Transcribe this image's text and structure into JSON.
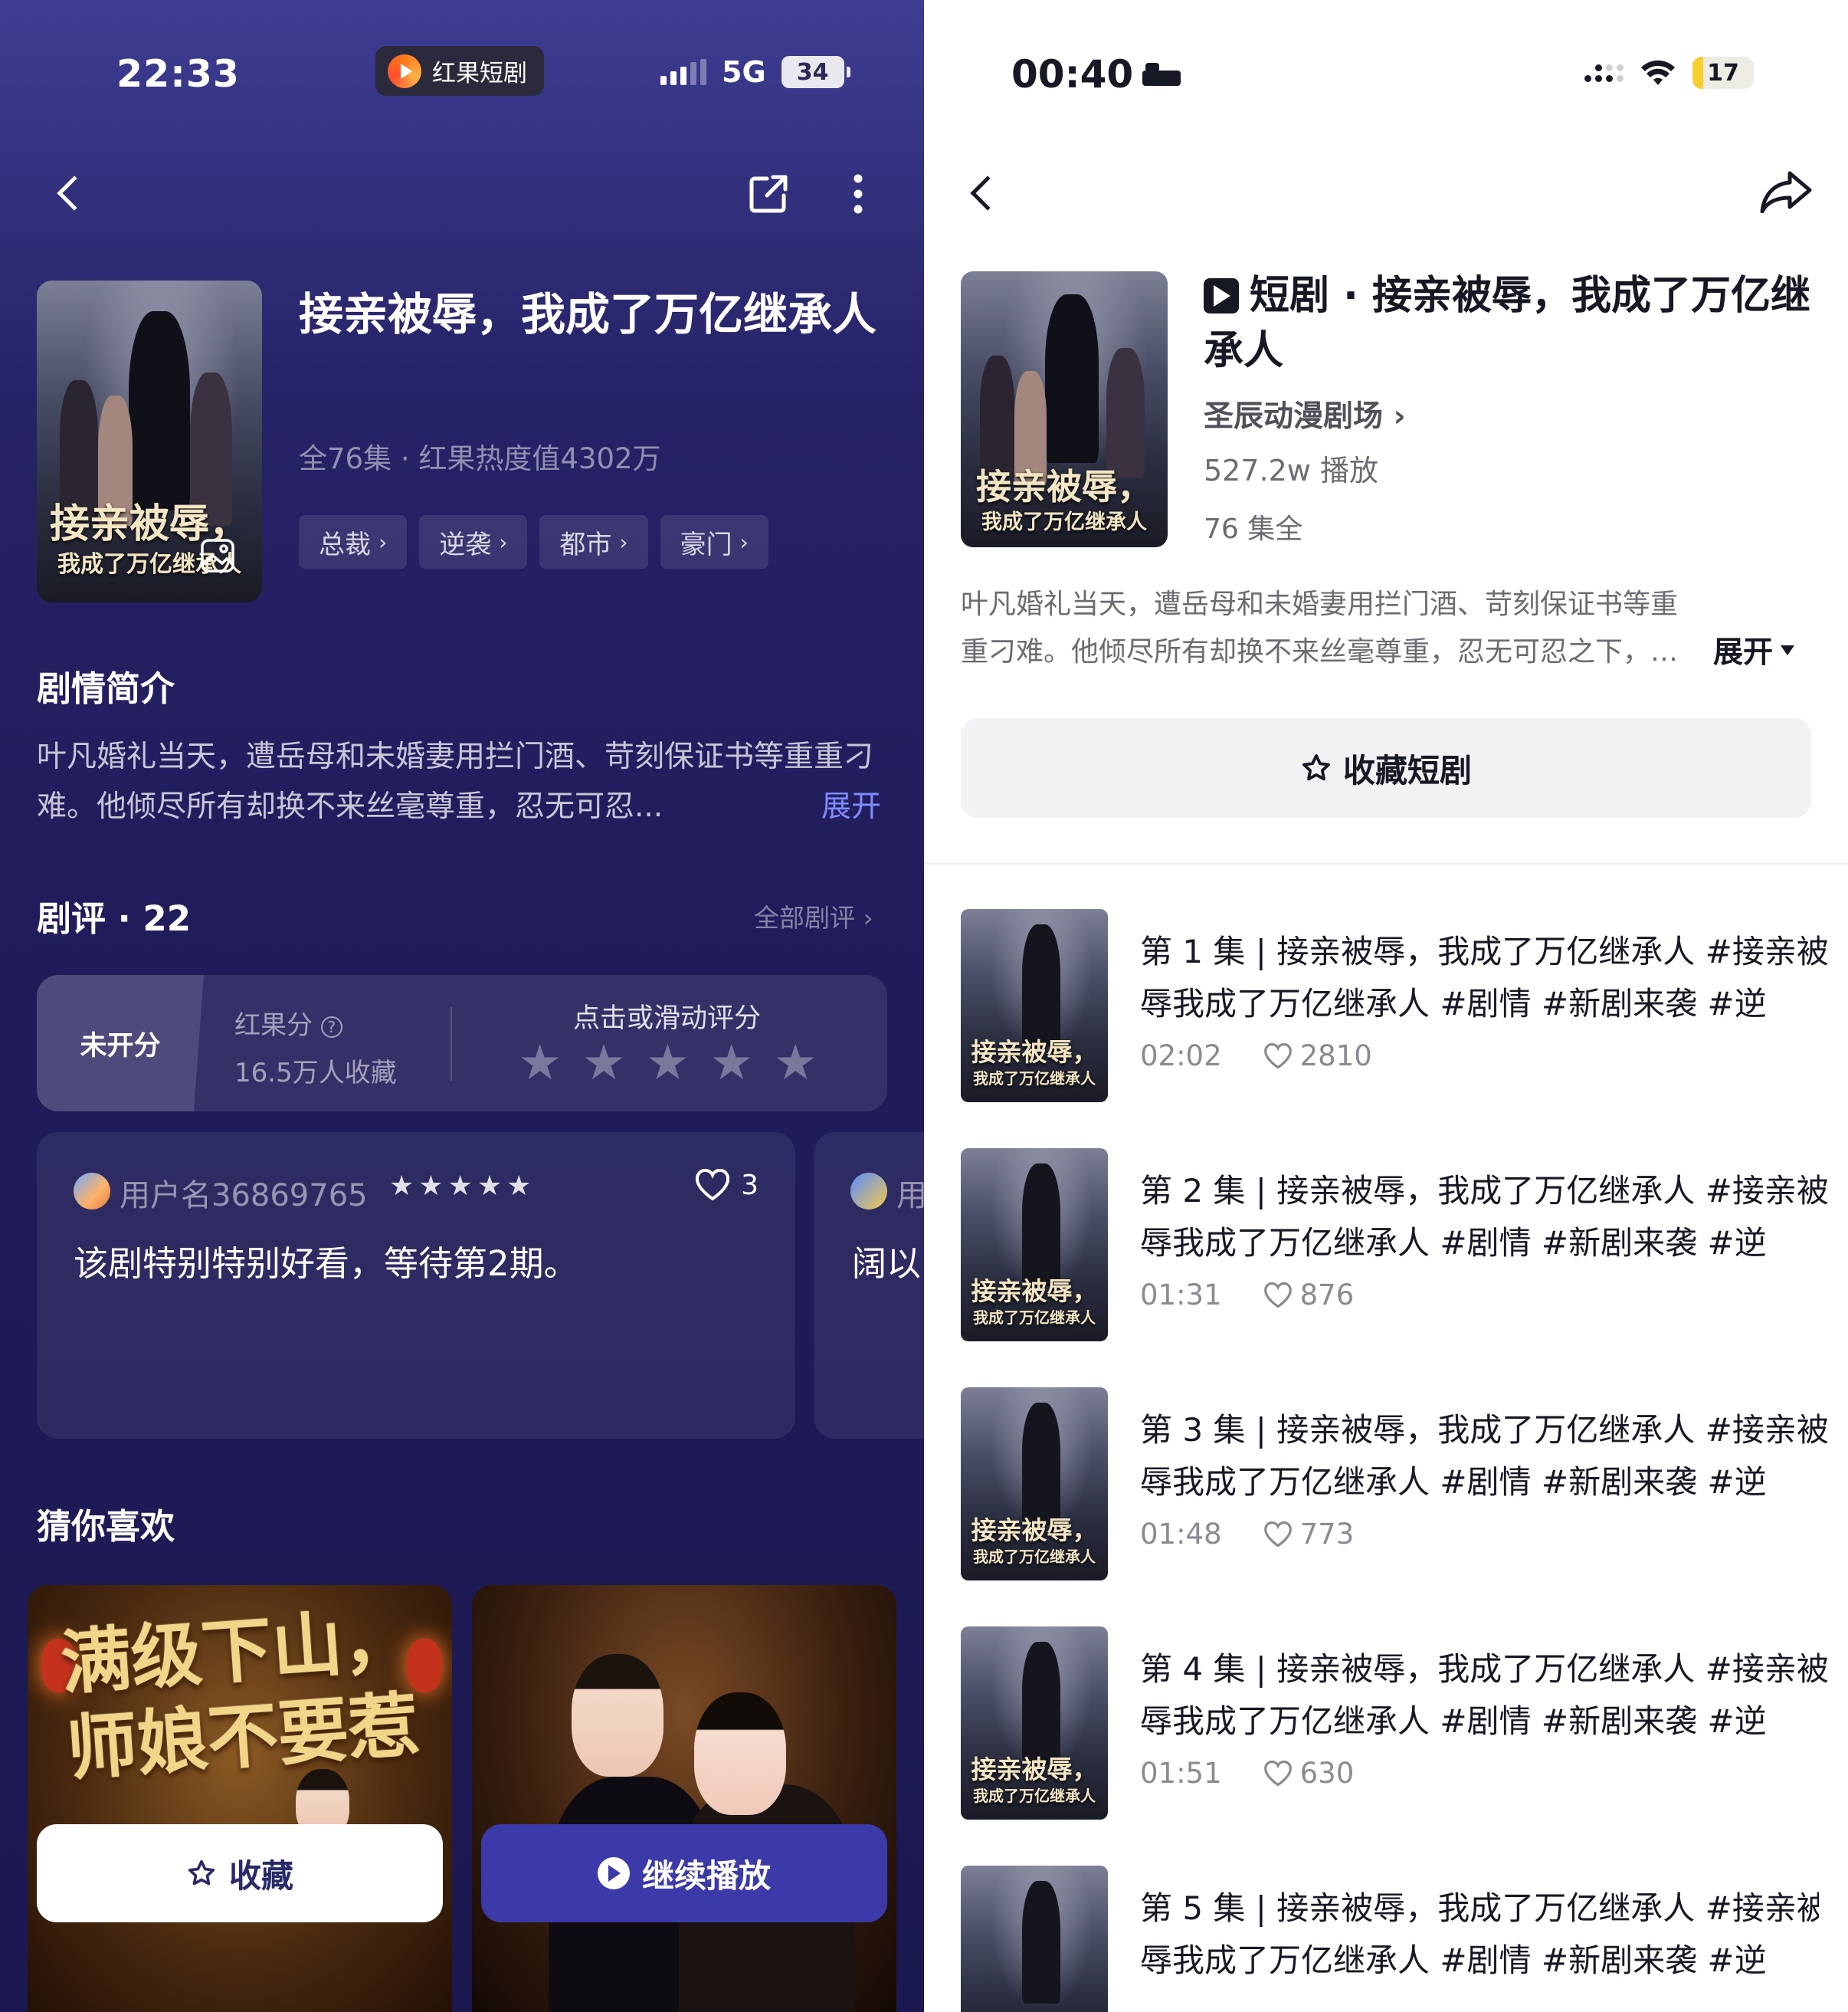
{
  "left": {
    "status_bar": {
      "time": "22:33",
      "app_name": "红果短剧",
      "network": "5G",
      "battery": "34"
    },
    "drama": {
      "title": "接亲被辱，我成了万亿继承人",
      "meta": "全76集 · 红果热度值4302万",
      "poster_caption_line1": "接亲被辱，",
      "poster_caption_line2": "我成了万亿继承人",
      "tags": [
        "总裁",
        "逆袭",
        "都市",
        "豪门"
      ]
    },
    "synopsis": {
      "heading": "剧情简介",
      "text": "叶凡婚礼当天，遭岳母和未婚妻用拦门酒、苛刻保证书等重重刁难。他倾尽所有却换不来丝毫尊重，忍无可忍...",
      "expand": "展开"
    },
    "reviews": {
      "heading": "剧评 · 22",
      "all_link": "全部剧评",
      "rating": {
        "unscored": "未开分",
        "score_label": "红果分",
        "favorites": "16.5万人收藏",
        "hint": "点击或滑动评分",
        "stars": 5
      },
      "items": [
        {
          "user": "用户名36869765",
          "stars": 5,
          "likes": "3",
          "text": "该剧特别特别好看，等待第2期。"
        },
        {
          "user": "用",
          "text": "阔以"
        }
      ]
    },
    "recommend": {
      "heading": "猜你喜欢",
      "cards": [
        {
          "title_line1": "满级下山，",
          "title_line2": "师娘不要惹"
        },
        {
          "title_line1": "",
          "title_line2": ""
        }
      ]
    },
    "actions": {
      "favorite": "收藏",
      "continue": "继续播放"
    },
    "colors": {
      "accent": "#7f8cff",
      "play_button": "#3b3aa8",
      "bg": "#211d5c"
    }
  },
  "right": {
    "status_bar": {
      "time": "00:40",
      "battery": "17",
      "battery_level": 0.17
    },
    "drama": {
      "title": "短剧 · 接亲被辱，我成了万亿继承人",
      "studio": "圣辰动漫剧场",
      "plays": "527.2w 播放",
      "episodes": "76 集全",
      "poster_caption_line1": "接亲被辱，",
      "poster_caption_line2": "我成了万亿继承人"
    },
    "synopsis": {
      "text": "叶凡婚礼当天，遭岳母和未婚妻用拦门酒、苛刻保证书等重重刁难。他倾尽所有却换不来丝毫尊重，忍无可忍之下，…",
      "expand": "展开"
    },
    "favorite_button": "收藏短剧",
    "episodes": [
      {
        "title": "第 1 集 | 接亲被辱，我成了万亿继承人 #接亲被辱我成了万亿继承人 #剧情 #新剧来袭 #逆",
        "duration": "02:02",
        "likes": "2810"
      },
      {
        "title": "第 2 集 | 接亲被辱，我成了万亿继承人 #接亲被辱我成了万亿继承人 #剧情 #新剧来袭 #逆",
        "duration": "01:31",
        "likes": "876"
      },
      {
        "title": "第 3 集 | 接亲被辱，我成了万亿继承人 #接亲被辱我成了万亿继承人 #剧情 #新剧来袭 #逆",
        "duration": "01:48",
        "likes": "773"
      },
      {
        "title": "第 4 集 | 接亲被辱，我成了万亿继承人 #接亲被辱我成了万亿继承人 #剧情 #新剧来袭 #逆",
        "duration": "01:51",
        "likes": "630"
      },
      {
        "title": "第 5 集 | 接亲被辱，我成了万亿继承人 #接亲被辱我成了万亿继承人 #剧情 #新剧来袭 #逆",
        "duration": "",
        "likes": ""
      }
    ]
  }
}
